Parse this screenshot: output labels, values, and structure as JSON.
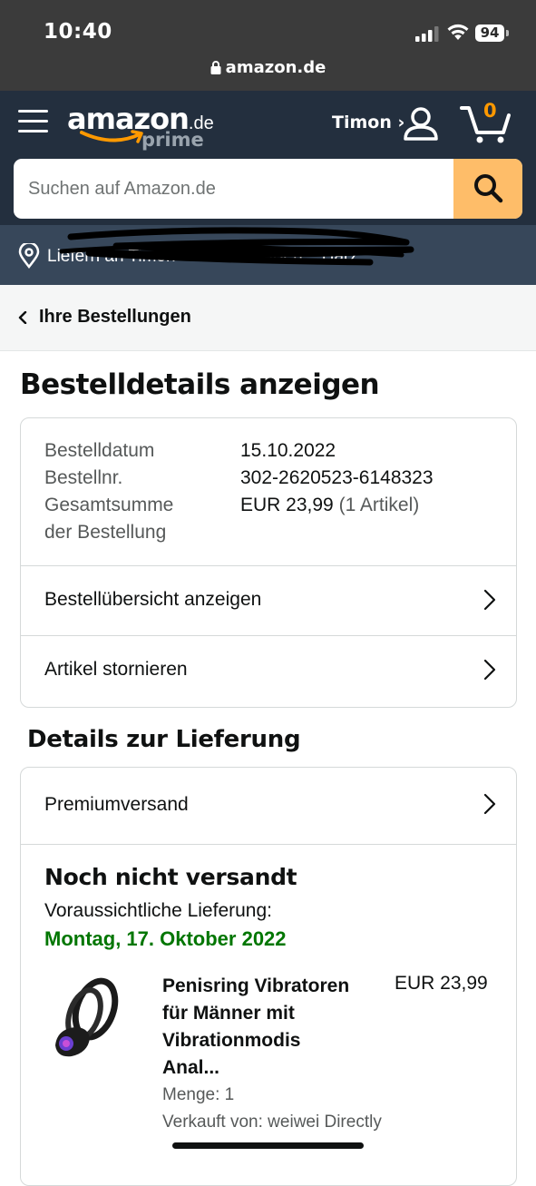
{
  "status_bar": {
    "time": "10:40",
    "battery": "94",
    "url": "amazon.de"
  },
  "header": {
    "logo_text": "amazon",
    "logo_domain": ".de",
    "logo_prime": "prime",
    "user_label": "Timon ›",
    "cart_count": "0"
  },
  "search": {
    "placeholder": "Suchen auf Amazon.de"
  },
  "delivery_bar": {
    "text": "Liefern an Timon - 37?00 Weißen... Harz"
  },
  "breadcrumb": {
    "label": "Ihre Bestellungen"
  },
  "page_title": "Bestelldetails anzeigen",
  "order_info": {
    "date_label": "Bestelldatum",
    "date_value": "15.10.2022",
    "number_label": "Bestellnr.",
    "number_value": "302-2620523-6148323",
    "total_label_1": "Gesamtsumme",
    "total_label_2": "der Bestellung",
    "total_value": "EUR 23,99",
    "total_count": "(1 Artikel)",
    "overview_link": "Bestellübersicht anzeigen",
    "cancel_link": "Artikel stornieren"
  },
  "delivery": {
    "section_title": "Details zur Lieferung",
    "shipping_method": "Premiumversand",
    "status": "Noch nicht versandt",
    "eta_label": "Voraussichtliche Lieferung:",
    "eta_date": "Montag, 17. Oktober 2022",
    "eta_color": "#007600"
  },
  "product": {
    "name_1": "Penisring Vibratoren",
    "name_2": "für Männer mit",
    "name_3": "Vibrationmodis",
    "name_4": "Anal...",
    "price": "EUR 23,99",
    "quantity": "Menge: 1",
    "seller": "Verkauft von: weiwei Directly"
  },
  "colors": {
    "header_bg": "#232f3e",
    "deliver_bg": "#37475a",
    "search_button": "#febd69",
    "accent": "#ff9900"
  }
}
